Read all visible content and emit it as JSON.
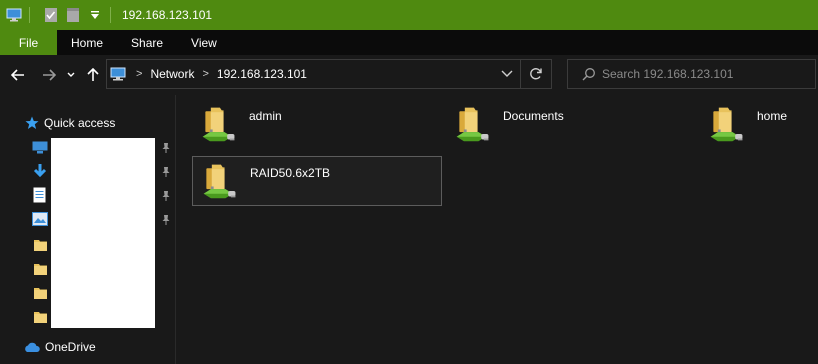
{
  "window": {
    "title": "192.168.123.101",
    "quick_access_toolbar": [
      "computer-icon",
      "properties-icon",
      "new-folder-icon",
      "customize-dropdown-icon"
    ]
  },
  "ribbon": {
    "tabs": [
      {
        "label": "File",
        "active": true
      },
      {
        "label": "Home"
      },
      {
        "label": "Share"
      },
      {
        "label": "View"
      }
    ]
  },
  "navigation": {
    "back": "arrow-left-icon",
    "forward": "arrow-right-icon",
    "recent": "chevron-down-icon",
    "up": "arrow-up-icon"
  },
  "address": {
    "breadcrumbs": [
      "Network",
      "192.168.123.101"
    ]
  },
  "search": {
    "placeholder": "Search 192.168.123.101"
  },
  "sidebar": {
    "quick_access": "Quick access",
    "onedrive": "OneDrive",
    "pinned_items_icons": [
      "desktop-icon",
      "downloads-icon",
      "documents-icon",
      "pictures-icon",
      "folder-icon",
      "folder-icon",
      "folder-icon",
      "folder-icon"
    ]
  },
  "shares": [
    {
      "name": "admin"
    },
    {
      "name": "Documents"
    },
    {
      "name": "home"
    },
    {
      "name": "RAID50.6x2TB",
      "selected": true
    }
  ],
  "colors": {
    "accent_green": "#4f8a10",
    "background": "#191919",
    "folder_yellow": "#e8c25c",
    "network_green": "#5cb82e"
  }
}
